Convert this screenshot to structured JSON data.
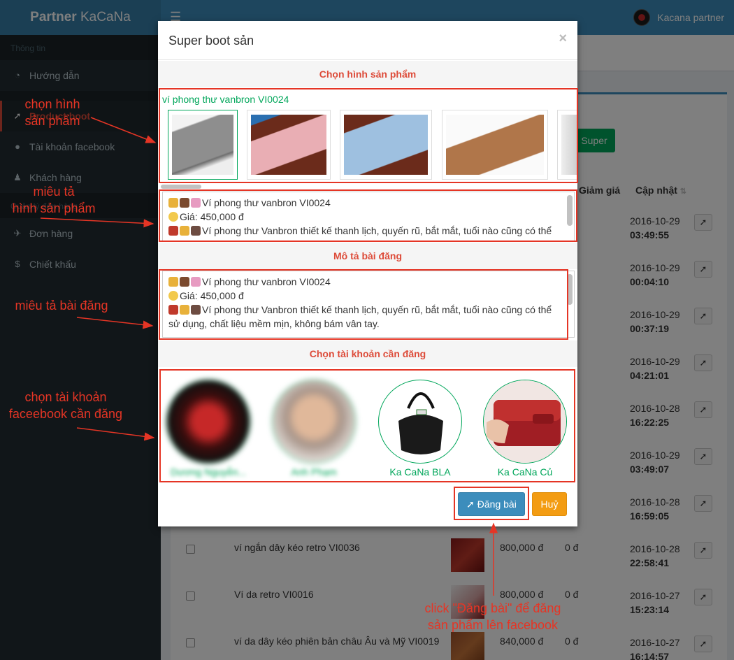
{
  "app": {
    "brand_bold": "Partner",
    "brand_rest": " KaCaNa",
    "user_name": "Kacana partner"
  },
  "sidebar": {
    "header1": "Thông tin",
    "items": [
      {
        "label": "Hướng dẫn",
        "icon": "dashboard-icon"
      },
      {
        "label": "Product boot",
        "icon": "rocket-icon"
      },
      {
        "label": "Tài khoản facebook",
        "icon": "globe-icon"
      },
      {
        "label": "Khách hàng",
        "icon": "user-icon"
      },
      {
        "label": "Đơn hàng",
        "icon": "plane-icon"
      },
      {
        "label": "Chiết khấu",
        "icon": "dollar-icon"
      }
    ],
    "header2": "Quản lý đơn hàng"
  },
  "table": {
    "col_discount": "Giảm giá",
    "col_updated": "Cập nhật",
    "green_button": "Super boot",
    "rows": [
      {
        "name": "",
        "price": "",
        "discount": "",
        "date": "2016-10-29",
        "time": "03:49:55"
      },
      {
        "name": "",
        "price": "",
        "discount": "",
        "date": "2016-10-29",
        "time": "00:04:10"
      },
      {
        "name": "",
        "price": "",
        "discount": "",
        "date": "2016-10-29",
        "time": "00:37:19"
      },
      {
        "name": "",
        "price": "",
        "discount": "",
        "date": "2016-10-29",
        "time": "04:21:01"
      },
      {
        "name": "",
        "price": "",
        "discount": "",
        "date": "2016-10-28",
        "time": "16:22:25"
      },
      {
        "name": "",
        "price": "",
        "discount": "",
        "date": "2016-10-29",
        "time": "03:49:07"
      },
      {
        "name": "",
        "price": "",
        "discount": "",
        "date": "2016-10-28",
        "time": "16:59:05"
      },
      {
        "name": "ví ngắn dây kéo retro VI0036",
        "price": "800,000 đ",
        "discount": "0 đ",
        "date": "2016-10-28",
        "time": "22:58:41"
      },
      {
        "name": "Ví da retro VI0016",
        "price": "800,000 đ",
        "discount": "0 đ",
        "date": "2016-10-27",
        "time": "15:23:14"
      },
      {
        "name": "ví da dây kéo phiên bản châu Âu và Mỹ VI0019",
        "price": "840,000 đ",
        "discount": "0 đ",
        "date": "2016-10-27",
        "time": "16:14:57"
      }
    ]
  },
  "modal": {
    "title": "Super boot sản",
    "close": "×",
    "section_images": "Chọn hình sản phẩm",
    "product_name": "ví phong thư vanbron VI0024",
    "image_desc": {
      "line1": "Ví phong thư vanbron VI0024",
      "line2": "Giá: 450,000 đ",
      "line3": "Ví phong thư Vanbron thiết kế thanh lịch, quyến rũ, bắt mắt, tuổi nào cũng có thể"
    },
    "section_post": "Mô tả bài đăng",
    "post_desc": {
      "line1": "Ví phong thư vanbron VI0024",
      "line2": "Giá: 450,000 đ",
      "line3": "Ví phong thư Vanbron thiết kế thanh lịch, quyến rũ, bắt mắt, tuổi nào cũng có thể",
      "line4": "sử dụng, chất liệu mềm mịn, không bám vân tay."
    },
    "section_accounts": "Chọn tài khoản cần đăng",
    "accounts": [
      {
        "name": "Dương Nguyễn..."
      },
      {
        "name": "Anh Phạm"
      },
      {
        "name": "Ka CaNa BLA"
      },
      {
        "name": "Ka CaNa Củ"
      }
    ],
    "post_button": "Đăng bài",
    "cancel_button": "Huỷ"
  },
  "annotations": {
    "choose_image": "chọn hình\nsản phẩm",
    "image_desc": "miêu tả\nhình sản phẩm",
    "post_desc": "miêu tả bài đăng",
    "choose_account": "chọn tài khoản\nfaceebook cần đăng",
    "click_post": "click \"Đăng bài\" để đăng\nsản phẩm lên facebook"
  },
  "colors": {
    "accent_red": "#e53525",
    "primary": "#3c8dbc",
    "success": "#00a65a",
    "warning": "#f39c12"
  }
}
